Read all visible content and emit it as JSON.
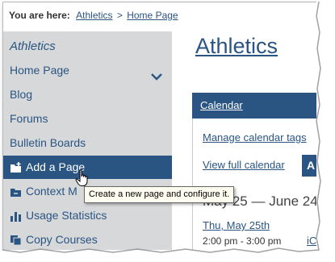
{
  "breadcrumb": {
    "prefix": "You are here:",
    "items": [
      "Athletics",
      "Home Page"
    ],
    "separator": ">"
  },
  "sidebar": {
    "title": "Athletics",
    "items": [
      {
        "label": "Home Page",
        "icon": "chevron-down-icon"
      },
      {
        "label": "Blog"
      },
      {
        "label": "Forums"
      },
      {
        "label": "Bulletin Boards"
      },
      {
        "label": "Add a Page",
        "icon": "add-page-icon",
        "active": true
      },
      {
        "label": "Context M",
        "icon": "context-icon"
      },
      {
        "label": "Usage Statistics",
        "icon": "bar-chart-icon"
      },
      {
        "label": "Copy Courses",
        "icon": "copy-icon"
      }
    ]
  },
  "tooltip": "Create a new page and configure it.",
  "main": {
    "title": "Athletics",
    "calendar": {
      "header": "Calendar",
      "manage_link": "Manage calendar tags",
      "full_link": "View full calendar",
      "add_button": "A",
      "range": "May 25 — June 24",
      "event_date": "Thu, May 25th",
      "event_time": "2:00 pm - 3:00 pm",
      "event_link": "iC"
    }
  },
  "colors": {
    "brand": "#2a5583",
    "sidebar_bg": "#d6d8da",
    "tooltip_bg": "#fffef0"
  }
}
